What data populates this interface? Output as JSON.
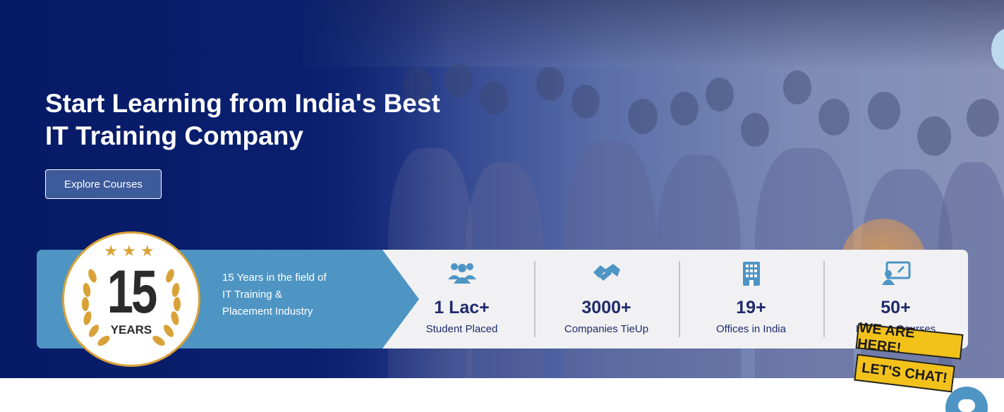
{
  "hero": {
    "title_line1": "Start Learning from India's Best",
    "title_line2": "IT Training Company",
    "cta_label": "Explore Courses"
  },
  "badge": {
    "number": "15",
    "label": "YEARS"
  },
  "experience": {
    "line1": "15 Years in the field of",
    "line2": "IT Training &",
    "line3": "Placement Industry"
  },
  "stats": [
    {
      "value": "1 Lac+",
      "label": "Student Placed",
      "icon": "users-icon"
    },
    {
      "value": "3000+",
      "label": "Companies TieUp",
      "icon": "handshake-icon"
    },
    {
      "value": "19+",
      "label": "Offices in India",
      "icon": "building-icon"
    },
    {
      "value": "50+",
      "label": "Industry Courses",
      "icon": "presentation-icon"
    }
  ],
  "chat_widget": {
    "line1": "WE ARE HERE!",
    "line2": "LET'S CHAT!"
  },
  "colors": {
    "navy": "#0a1f6e",
    "accent_blue": "#4e95c4",
    "stat_text": "#1f2a6b",
    "gold": "#d9a238",
    "chat_yellow": "#f2c21b"
  }
}
